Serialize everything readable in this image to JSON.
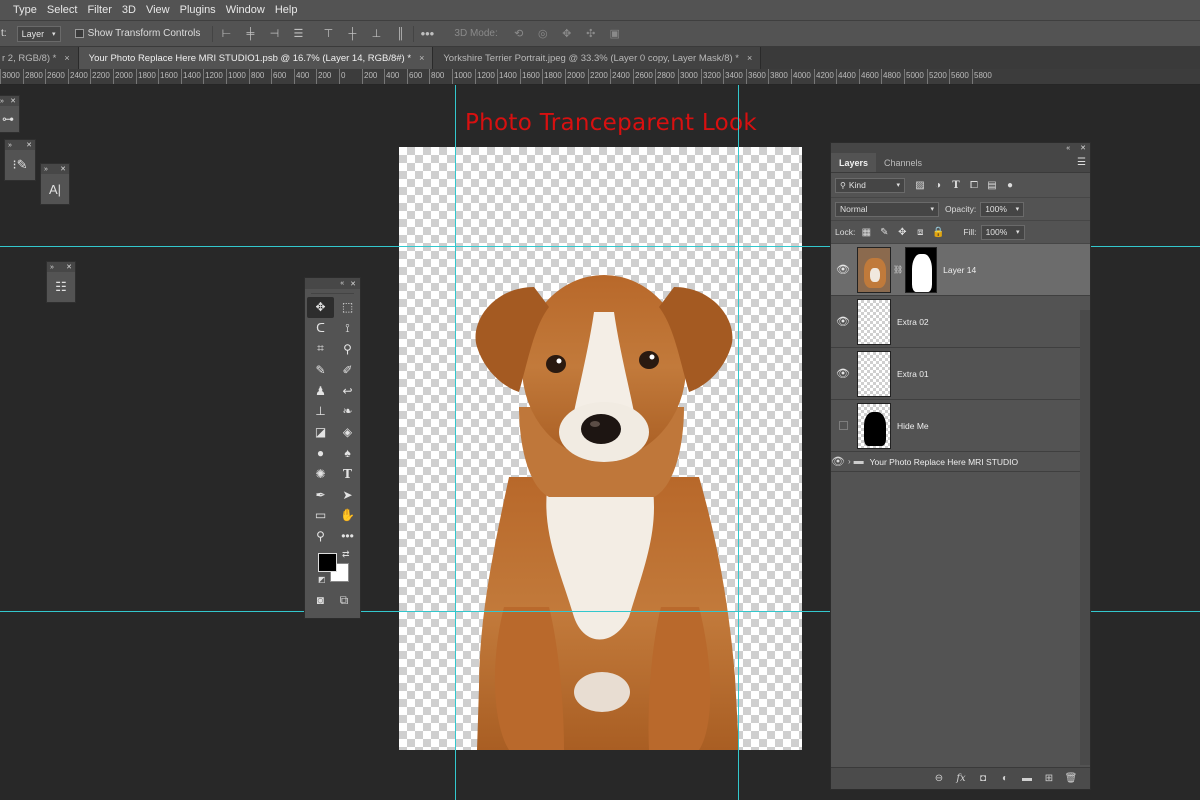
{
  "menu": [
    "Type",
    "Select",
    "Filter",
    "3D",
    "View",
    "Plugins",
    "Window",
    "Help"
  ],
  "options": {
    "prefix": "t:",
    "layer_select": "Layer",
    "show_transform": "Show Transform Controls",
    "mode_3d": "3D Mode:"
  },
  "tabs": [
    {
      "label": "r 2, RGB/8) *",
      "close": "×"
    },
    {
      "label": "Your Photo Replace Here MRI STUDIO1.psb @ 16.7% (Layer 14, RGB/8#) *",
      "close": "×"
    },
    {
      "label": "Yorkshire Terrier Portrait.jpeg @ 33.3% (Layer 0 copy, Layer Mask/8) *",
      "close": "×"
    }
  ],
  "ruler_labels": [
    "3000",
    "2800",
    "2600",
    "2400",
    "2200",
    "2000",
    "1800",
    "1600",
    "1400",
    "1200",
    "1000",
    "800",
    "600",
    "400",
    "200",
    "0",
    "200",
    "400",
    "600",
    "800",
    "1000",
    "1200",
    "1400",
    "1600",
    "1800",
    "2000",
    "2200",
    "2400",
    "2600",
    "2800",
    "3000",
    "3200",
    "3400",
    "3600",
    "3800",
    "4000",
    "4200",
    "4400",
    "4600",
    "4800",
    "5000",
    "5200",
    "5600",
    "5800"
  ],
  "canvas": {
    "heading": "Photo Tranceparent Look",
    "heading_color": "#d81010",
    "guide_color": "#33c7cd"
  },
  "mini_panels": {
    "text_tool": "A|"
  },
  "layers_panel": {
    "tab_layers": "Layers",
    "tab_channels": "Channels",
    "kind": "Kind",
    "blend_mode": "Normal",
    "opacity_label": "Opacity:",
    "opacity_value": "100%",
    "lock_label": "Lock:",
    "fill_label": "Fill:",
    "fill_value": "100%",
    "layers": [
      {
        "name": "Layer 14",
        "visible": true,
        "active": true
      },
      {
        "name": "Extra 02",
        "visible": true,
        "active": false
      },
      {
        "name": "Extra 01",
        "visible": true,
        "active": false
      },
      {
        "name": "Hide Me",
        "visible": false,
        "active": false
      }
    ],
    "group_name": "Your Photo Replace Here MRI STUDIO"
  }
}
